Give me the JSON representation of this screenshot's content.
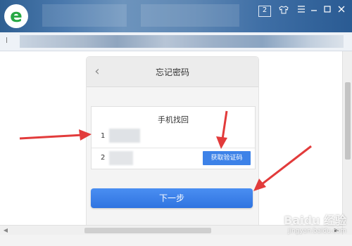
{
  "titlebar": {
    "logo_icon": "browser-e-logo-icon",
    "logo_glyph": "e",
    "tab_count": "2",
    "buttons": [
      "skin-icon",
      "menu-icon",
      "minimize-icon",
      "maximize-icon",
      "close-icon"
    ]
  },
  "colors": {
    "accent_blue": "#3d82e8",
    "arrow_red": "#e23b3b",
    "logo_green": "#27a844"
  },
  "panel": {
    "title": "忘记密码",
    "back_icon": "back-chevron-icon",
    "card_title": "手机找回",
    "phone_prefix": "1",
    "code_prefix": "2",
    "get_code_label": "获取验证码",
    "next_label": "下一步"
  },
  "watermark": {
    "brand": "Baidu 经验",
    "url": "jingyan.baidu.com"
  }
}
